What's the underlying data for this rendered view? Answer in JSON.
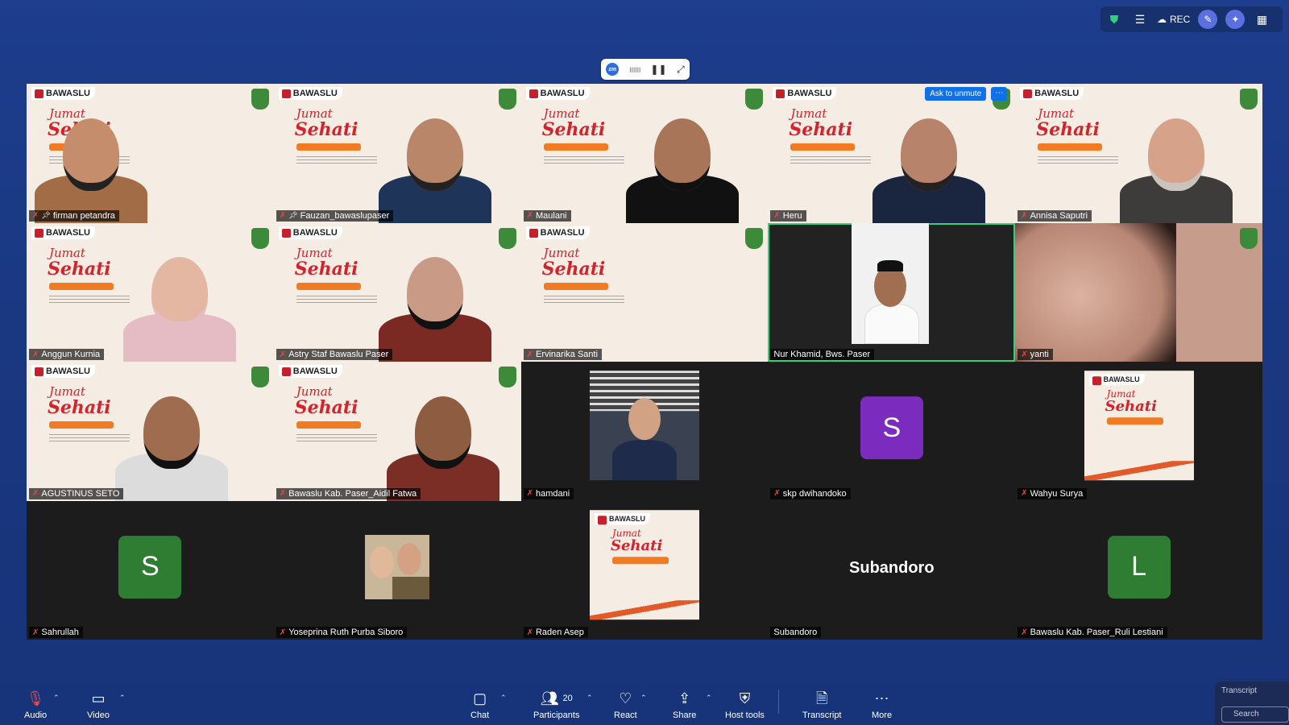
{
  "top_bar": {
    "rec_label": "REC"
  },
  "participants": [
    {
      "name": "firman petandra",
      "muted": true,
      "pinned": true,
      "bg": true
    },
    {
      "name": "Fauzan_bawaslupaser",
      "muted": true,
      "pinned": true,
      "bg": true
    },
    {
      "name": "Maulani",
      "muted": true,
      "bg": true
    },
    {
      "name": "Heru",
      "muted": true,
      "bg": true,
      "ask_unmute": "Ask to unmute"
    },
    {
      "name": "Annisa Saputri",
      "muted": true,
      "bg": true
    },
    {
      "name": "Anggun Kurnia",
      "muted": true,
      "bg": true
    },
    {
      "name": "Astry Staf Bawaslu Paser",
      "muted": true,
      "bg": true
    },
    {
      "name": "Ervinarika Santi",
      "muted": true,
      "bg": true
    },
    {
      "name": "Nur Khamid, Bws. Paser",
      "muted": false,
      "selected": true
    },
    {
      "name": "yanti",
      "muted": true
    },
    {
      "name": "AGUSTINUS SETO",
      "muted": true,
      "bg": true
    },
    {
      "name": "Bawaslu Kab. Paser_Aidil Fatwa",
      "muted": true,
      "bg": true
    },
    {
      "name": "hamdani",
      "muted": true
    },
    {
      "name": "skp dwihandoko",
      "muted": true,
      "avatar_letter": "S"
    },
    {
      "name": "Wahyu Surya",
      "muted": true
    },
    {
      "name": "Sahrullah",
      "muted": true,
      "avatar_letter": "S"
    },
    {
      "name": "Yoseprina Ruth Purba Siboro",
      "muted": true
    },
    {
      "name": "Raden Asep",
      "muted": true
    },
    {
      "name": "Subandoro",
      "muted": false,
      "display_name": "Subandoro"
    },
    {
      "name": "Bawaslu Kab. Paser_Ruli Lestiani",
      "muted": true,
      "avatar_letter": "L"
    }
  ],
  "banner": {
    "org": "BAWASLU",
    "line1": "Jumat",
    "line2": "Sehati"
  },
  "toolbar": {
    "audio": "Audio",
    "video": "Video",
    "chat": "Chat",
    "participants": "Participants",
    "participants_count": "20",
    "react": "React",
    "share": "Share",
    "host_tools": "Host tools",
    "transcript": "Transcript",
    "more": "More"
  },
  "transcript_panel": {
    "title": "Transcript",
    "search_placeholder": "Search"
  },
  "colors": {
    "selected_border": "#2fd27a",
    "purple_avatar": "#7b2bbd",
    "green_avatar": "#2e7d32",
    "unmute_blue": "#0e71eb"
  }
}
